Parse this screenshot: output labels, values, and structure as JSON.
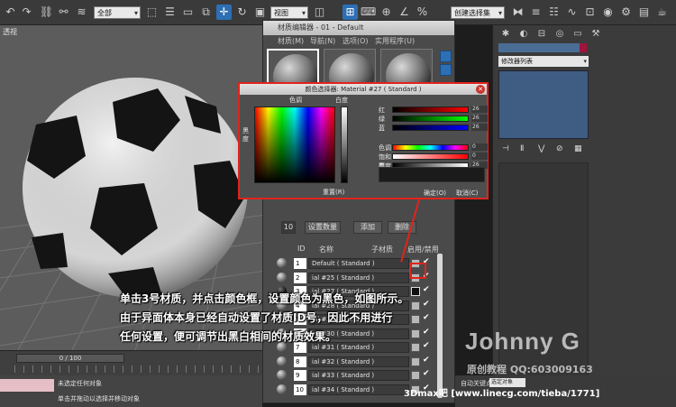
{
  "toolbar": {
    "selection_filter": "全部",
    "view_dropdown": "视图",
    "named_set": "创建选择集"
  },
  "viewport": {
    "label": "透视"
  },
  "material_editor": {
    "title": "材质编辑器 - 01 - Default",
    "menus": [
      "材质(M)",
      "导航(N)",
      "选项(O)",
      "实用程序(U)"
    ],
    "set_count_value": "10",
    "buttons": {
      "set_count": "设置数量",
      "add": "添加",
      "delete": "删除"
    },
    "table_headers": {
      "id": "ID",
      "name": "名称",
      "sub_material": "子材质",
      "on_off": "启用/禁用"
    },
    "rows": [
      {
        "id": "1",
        "name": "Default  ( Standard )",
        "swatch": "#b8b8b8"
      },
      {
        "id": "2",
        "name": "ial #25  ( Standard )",
        "swatch": "#b8b8b8"
      },
      {
        "id": "3",
        "name": "ial #27  ( Standard )",
        "swatch": "#111111"
      },
      {
        "id": "4",
        "name": "ial #28  ( Standard )",
        "swatch": "#b8b8b8"
      },
      {
        "id": "5",
        "name": "ial #29  ( Standard )",
        "swatch": "#b8b8b8"
      },
      {
        "id": "6",
        "name": "ial #30  ( Standard )",
        "swatch": "#b8b8b8"
      },
      {
        "id": "7",
        "name": "ial #31  ( Standard )",
        "swatch": "#b8b8b8"
      },
      {
        "id": "8",
        "name": "ial #32  ( Standard )",
        "swatch": "#b8b8b8"
      },
      {
        "id": "9",
        "name": "ial #33  ( Standard )",
        "swatch": "#b8b8b8"
      },
      {
        "id": "10",
        "name": "ial #34  ( Standard )",
        "swatch": "#b8b8b8"
      }
    ]
  },
  "color_selector": {
    "title": "颜色选择器: Material #27 ( Standard )",
    "hue_label": "色调",
    "white_label": "白度",
    "black_label": "黑度",
    "reset": "重置(R)",
    "ok": "确定(O)",
    "cancel": "取消(C)",
    "sliders": [
      {
        "label": "红",
        "value": "26"
      },
      {
        "label": "绿",
        "value": "26"
      },
      {
        "label": "蓝",
        "value": "26"
      },
      {
        "label": "色调",
        "value": "0"
      },
      {
        "label": "饱和度",
        "value": "0"
      },
      {
        "label": "亮度",
        "value": "26"
      }
    ]
  },
  "command_panel": {
    "modifier_list": "修改器列表"
  },
  "timeline": {
    "frame": "0 / 100"
  },
  "status": {
    "line1": "未选定任何对象",
    "line2": "单击并拖动以选择并移动对象",
    "auto_key": "自动关键点",
    "key_selection": "选定对象"
  },
  "caption": "单击3号材质，并点击颜色框，设置颜色为黑色，如图所示。\n由于异面体本身已经自动设置了材质ID号，因此不用进行\n任何设置，便可调节出黑白相间的材质效果。",
  "watermark": {
    "name": "Johnny G",
    "sub": "原创教程  QQ:603009163"
  },
  "site": "3Dmax吧  [www.linecg.com/tieba/1771]",
  "colors": {
    "accent": "#2d6fb4",
    "highlight": "#e0241c"
  }
}
